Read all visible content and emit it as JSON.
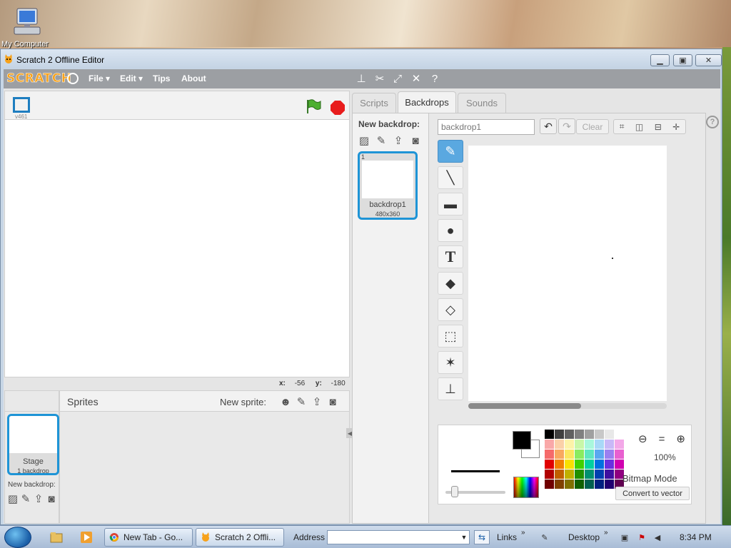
{
  "desktop": {
    "my_computer_label": "My Computer"
  },
  "window": {
    "title": "Scratch 2 Offline Editor"
  },
  "menubar": {
    "logo": "SCRATCH",
    "file": "File ▾",
    "edit": "Edit ▾",
    "tips": "Tips",
    "about": "About"
  },
  "stage": {
    "version": "v461"
  },
  "coords": {
    "x_label": "x:",
    "x_value": "-56",
    "y_label": "y:",
    "y_value": "-180"
  },
  "sprites": {
    "title": "Sprites",
    "new_sprite_label": "New sprite:",
    "stage_label": "Stage",
    "stage_sub": "1 backdrop",
    "new_backdrop_label": "New backdrop:"
  },
  "tabs": {
    "scripts": "Scripts",
    "backdrops": "Backdrops",
    "sounds": "Sounds"
  },
  "backdrops_pane": {
    "new_backdrop_title": "New backdrop:",
    "item": {
      "number": "1",
      "name": "backdrop1",
      "size": "480x360"
    }
  },
  "editor": {
    "name_value": "backdrop1",
    "clear_label": "Clear",
    "zoom_percent": "100%",
    "mode_label": "Bitmap Mode",
    "convert_label": "Convert to vector"
  },
  "palette_colors": [
    "#000000",
    "#3f3f3f",
    "#606060",
    "#808080",
    "#a0a0a0",
    "#c8c8c8",
    "#e8e8e8",
    "#ffffff",
    "#f9a8a8",
    "#fbd0a8",
    "#fdf3a8",
    "#c8f7a8",
    "#a8f7dc",
    "#a8d8f7",
    "#c8b8f7",
    "#f3a8e8",
    "#f56a6a",
    "#f8a860",
    "#fbe660",
    "#8aeb60",
    "#5ee7c0",
    "#5aa8f0",
    "#9a80f0",
    "#e860d0",
    "#e00000",
    "#f08000",
    "#f8e000",
    "#40d000",
    "#00d0a0",
    "#0070e0",
    "#6a30e0",
    "#d000b0",
    "#b00000",
    "#c06000",
    "#c0b000",
    "#209000",
    "#009070",
    "#0040b0",
    "#4010a0",
    "#900080",
    "#700000",
    "#804000",
    "#807000",
    "#106000",
    "#006050",
    "#002080",
    "#200070",
    "#600050"
  ],
  "taskbar": {
    "chrome_task": "New Tab - Go...",
    "scratch_task": "Scratch 2 Offli...",
    "address_label": "Address",
    "links_label": "Links",
    "desktop_label": "Desktop",
    "clock": "8:34 PM"
  }
}
